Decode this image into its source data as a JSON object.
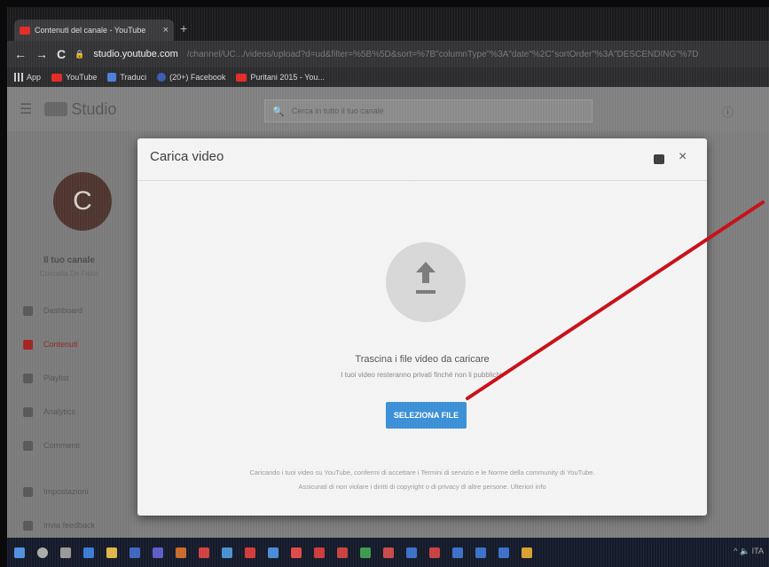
{
  "browser": {
    "tab_title": "Contenuti del canale - YouTube",
    "tab_close": "×",
    "new_tab": "+",
    "url": "studio.youtube.com",
    "url_rest": "/channel/UC.../videos/upload?d=ud&filter=%5B%5D&sort=%7B\"columnType\"%3A\"date\"%2C\"sortOrder\"%3A\"DESCENDING\"%7D",
    "bookmarks": [
      "App",
      "YouTube",
      "Traduci",
      "(20+) Facebook",
      "Puritani 2015 - You..."
    ]
  },
  "studio": {
    "logo_label": "Studio",
    "search_placeholder": "Cerca in tutto il tuo canale",
    "avatar_letter": "C",
    "channel_name": "Il tuo canale",
    "channel_sub": "Concetta De Falco",
    "nav": [
      "Dashboard",
      "Contenuti",
      "Playlist",
      "Analytics",
      "Commenti",
      "Impostazioni",
      "Invia feedback"
    ],
    "active_nav": "Contenuti"
  },
  "modal": {
    "title": "Carica video",
    "close": "×",
    "drop_title": "Trascina i file video da caricare",
    "drop_sub": "I tuoi video resteranno privati finché non li pubblichi.",
    "button_label": "SELEZIONA FILE",
    "terms_line1": "Caricando i tuoi video su YouTube, confermi di accettare i Termini di servizio e le Norme della community di YouTube.",
    "terms_line2": "Assicurati di non violare i diritti di copyright o di privacy di altre persone. Ulteriori info"
  },
  "colors": {
    "youtube_red": "#e32a24",
    "button_blue": "#3a8fd6",
    "annotation_arrow": "#c8121a"
  }
}
